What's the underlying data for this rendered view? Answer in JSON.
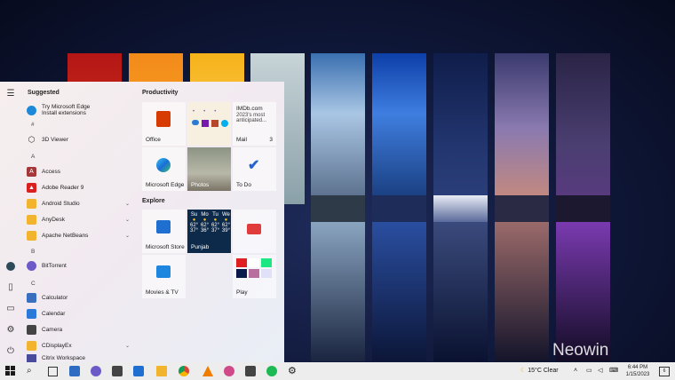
{
  "start_menu": {
    "suggested_title": "Suggested",
    "suggested": {
      "title": "Try Microsoft Edge",
      "subtitle": "Install extensions"
    },
    "apps": [
      {
        "label": "3D Viewer",
        "icon": "cube-icon",
        "color": "#444444"
      },
      {
        "label": "Access",
        "icon": "access-icon",
        "color": "#a4373a"
      },
      {
        "label": "Adobe Reader 9",
        "icon": "adobe-icon",
        "color": "#d9201f"
      },
      {
        "label": "Android Studio",
        "icon": "folder-icon",
        "color": "#f2b32e"
      },
      {
        "label": "AnyDesk",
        "icon": "folder-icon",
        "color": "#f2b32e"
      },
      {
        "label": "Apache NetBeans",
        "icon": "folder-icon",
        "color": "#f2b32e"
      },
      {
        "label": "BitTorrent",
        "icon": "bittorrent-icon",
        "color": "#6b5ac8"
      },
      {
        "label": "Calculator",
        "icon": "calculator-icon",
        "color": "#3a6fbf"
      },
      {
        "label": "Calendar",
        "icon": "calendar-icon",
        "color": "#2b79d8"
      },
      {
        "label": "Camera",
        "icon": "camera-icon",
        "color": "#444444"
      },
      {
        "label": "CDisplayEx",
        "icon": "folder-icon",
        "color": "#f2b32e"
      },
      {
        "label": "Citrix Workspace",
        "icon": "citrix-icon",
        "color": "#4a4a9c"
      }
    ],
    "letters": [
      "#",
      "A",
      "B",
      "C"
    ],
    "productivity_title": "Productivity",
    "explore_title": "Explore",
    "tiles": {
      "office": "Office",
      "imdb_title": "IMDb.com",
      "imdb_text": "2023's most anticipated...",
      "mail": "Mail",
      "mail_count": "3",
      "edge": "Microsoft Edge",
      "photos": "Photos",
      "todo": "To Do",
      "store": "Microsoft Store",
      "weather_location": "Punjab",
      "weather_days": [
        {
          "day": "Mo",
          "hi": "62°",
          "lo": "36°"
        },
        {
          "day": "Tu",
          "hi": "62°",
          "lo": "37°"
        },
        {
          "day": "We",
          "hi": "62°",
          "lo": "39°"
        }
      ],
      "weather_first_day": "Su",
      "weather_first_hi": "62°",
      "weather_first_lo": "37°",
      "movies": "Movies & TV",
      "play": "Play"
    }
  },
  "taskbar": {
    "weather_temp": "15°C",
    "weather_cond": "Clear",
    "time": "6:44 PM",
    "date": "1/15/2023",
    "notif_count": "6"
  },
  "watermark": "Neowin"
}
